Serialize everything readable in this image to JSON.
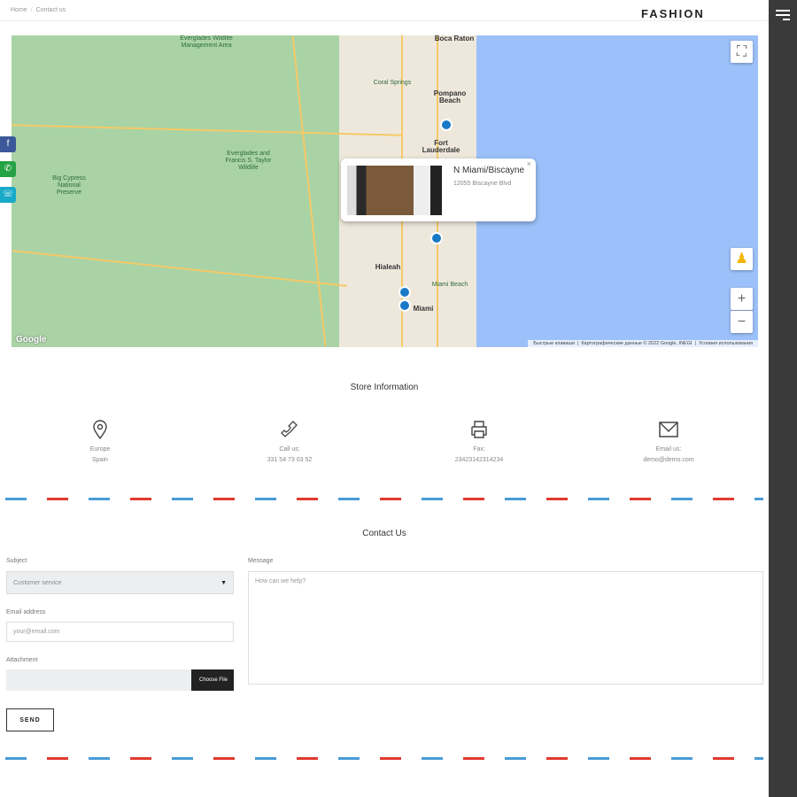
{
  "breadcrumb": [
    "Home",
    "Contact us"
  ],
  "logo": "FASHION",
  "map": {
    "labels": [
      {
        "text": "Boca Raton",
        "cls": "city"
      },
      {
        "text": "Pompano Beach",
        "cls": "city"
      },
      {
        "text": "Fort Lauderdale",
        "cls": "city"
      },
      {
        "text": "Hialeah",
        "cls": "city"
      },
      {
        "text": "Miami",
        "cls": "city"
      },
      {
        "text": "Miami Beach",
        "cls": ""
      },
      {
        "text": "Everglades Wildlife Management Area",
        "cls": ""
      },
      {
        "text": "Everglades and Francis S. Taylor Wildlife",
        "cls": ""
      },
      {
        "text": "Big Cypress National Preserve",
        "cls": ""
      },
      {
        "text": "Coral Springs",
        "cls": ""
      }
    ],
    "info": {
      "title": "N Miami/Biscayne",
      "address": "12055 Biscayne Blvd",
      "close": "×"
    },
    "attribution": [
      "Быстрые клавиши",
      "Картографические данные © 2022 Google, INEGI",
      "Условия использования"
    ],
    "google": "Google",
    "zoom_in": "+",
    "zoom_out": "−"
  },
  "social": [
    {
      "icon": "facebook-icon",
      "glyph": "f",
      "color": "#3b5998"
    },
    {
      "icon": "whatsapp-icon",
      "glyph": "✆",
      "color": "#25a244"
    },
    {
      "icon": "viber-icon",
      "glyph": "☏",
      "color": "#19a9c9"
    }
  ],
  "store": {
    "title": "Store Information",
    "items": [
      {
        "icon": "location-pin-icon",
        "lines": [
          "Europe",
          "Spain"
        ]
      },
      {
        "icon": "phone-icon",
        "lines": [
          "Call us:",
          "331 54 73 03 52"
        ]
      },
      {
        "icon": "printer-icon",
        "lines": [
          "Fax:",
          "23423142314234"
        ]
      },
      {
        "icon": "envelope-icon",
        "lines": [
          "Email us:",
          "demo@demo.com"
        ]
      }
    ]
  },
  "contact": {
    "title": "Contact Us",
    "subject_label": "Subject",
    "subject_value": "Customer service",
    "email_label": "Email address",
    "email_placeholder": "your@email.com",
    "attachment_label": "Attachment",
    "choose_file": "Choose File",
    "message_label": "Message",
    "message_placeholder": "How can we help?",
    "send": "SEND"
  }
}
